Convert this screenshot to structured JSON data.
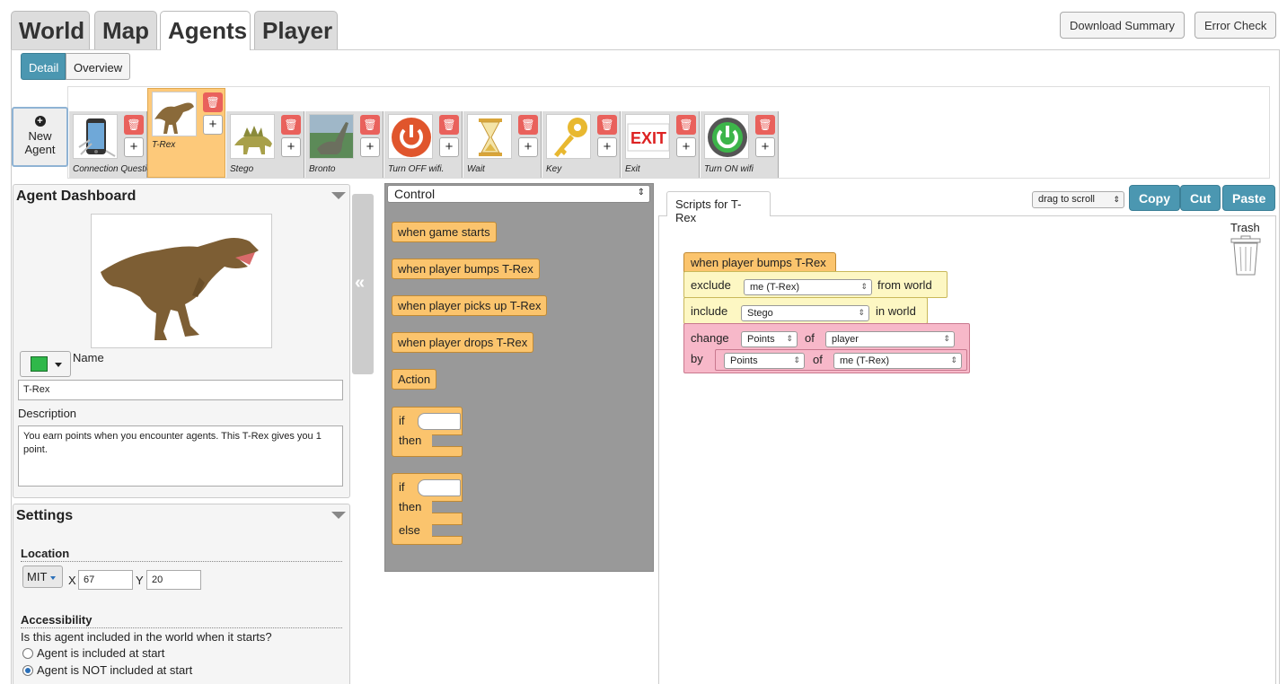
{
  "tabs": [
    "World",
    "Map",
    "Agents",
    "Player"
  ],
  "top_buttons": {
    "download": "Download Summary",
    "error": "Error Check"
  },
  "view_toggle": {
    "detail": "Detail",
    "overview": "Overview"
  },
  "new_agent": {
    "line1": "New",
    "line2": "Agent"
  },
  "agents": [
    {
      "name": "Connection Questio",
      "icon": "phone-icon"
    },
    {
      "name": "T-Rex",
      "icon": "dinosaur-icon",
      "selected": true
    },
    {
      "name": "Stego",
      "icon": "stegosaurus-icon"
    },
    {
      "name": "Bronto",
      "icon": "brontosaurus-icon"
    },
    {
      "name": "Turn OFF wifi.",
      "icon": "power-off-icon"
    },
    {
      "name": "Wait",
      "icon": "hourglass-icon"
    },
    {
      "name": "Key",
      "icon": "key-icon"
    },
    {
      "name": "Exit",
      "icon": "exit-sign-icon"
    },
    {
      "name": "Turn ON wifi",
      "icon": "power-on-icon"
    }
  ],
  "dashboard": {
    "title": "Agent Dashboard",
    "name_label": "Name",
    "name_value": "T-Rex",
    "description_label": "Description",
    "description_value": "You earn points when you encounter agents.  This T-Rex gives you 1 point."
  },
  "settings": {
    "title": "Settings",
    "location_label": "Location",
    "map_select": "MIT",
    "x_label": "X",
    "x_value": "67",
    "y_label": "Y",
    "y_value": "20",
    "accessibility_label": "Accessibility",
    "question": "Is this agent included in the world when it starts?",
    "option1": "Agent is included at start",
    "option2": "Agent is NOT included at start",
    "selected_option": 2
  },
  "palette": {
    "category": "Control",
    "blocks": [
      "when game starts",
      "when player bumps T-Rex",
      "when player picks up T-Rex",
      "when player drops T-Rex",
      "Action"
    ],
    "if": "if",
    "then": "then",
    "else": "else"
  },
  "scripts": {
    "tab": "Scripts for T-Rex",
    "scroll_select": "drag to scroll",
    "copy": "Copy",
    "cut": "Cut",
    "paste": "Paste",
    "trash": "Trash",
    "event": "when player bumps T-Rex",
    "exclude": "exclude",
    "exclude_target": "me (T-Rex)",
    "from_world": "from world",
    "include": "include",
    "include_target": "Stego",
    "in_world": "in world",
    "change": "change",
    "change_prop": "Points",
    "of1": "of",
    "change_obj": "player",
    "by": "by",
    "by_prop": "Points",
    "of2": "of",
    "by_obj": "me (T-Rex)"
  },
  "colors": {
    "accent": "#4b97b1",
    "event_block": "#fbc46d",
    "sensing_block": "#fdf7c3",
    "change_block": "#f7b8c9"
  }
}
